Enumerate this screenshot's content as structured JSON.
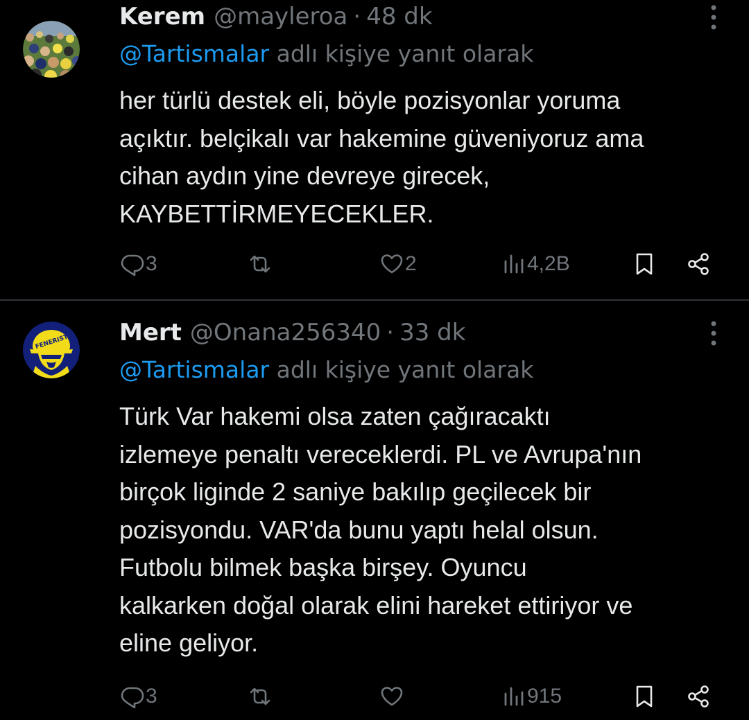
{
  "tweets": [
    {
      "name": "Kerem",
      "handle": "@mayleroa",
      "separator": "·",
      "time": "48 dk",
      "reply_mention": "@Tartismalar",
      "reply_suffix": "adlı kişiye yanıt olarak",
      "text_lines": [
        "her türlü destek eli, böyle pozisyonlar yoruma",
        "açıktır. belçikalı var hakemine güveniyoruz ama",
        "cihan aydın yine devreye girecek,",
        "KAYBETTİRMEYECEKLER."
      ],
      "replies": "3",
      "retweets": "",
      "likes": "2",
      "views": "4,2B",
      "avatar_icon": "crowd-photo-avatar"
    },
    {
      "name": "Mert",
      "handle": "@Onana256340",
      "separator": "·",
      "time": "33 dk",
      "reply_mention": "@Tartismalar",
      "reply_suffix": "adlı kişiye yanıt olarak",
      "text_lines": [
        "Türk Var hakemi olsa zaten çağıracaktı",
        "izlemeye penaltı vereceklerdi. PL ve Avrupa'nın",
        "birçok liginde 2 saniye bakılıp geçilecek bir",
        "pozisyondu. VAR'da bunu yaptı helal olsun.",
        "Futbolu bilmek başka birşey. Oyuncu",
        "kalkarken doğal olarak elini hareket ettiriyor ve",
        "eline geliyor."
      ],
      "replies": "3",
      "retweets": "",
      "likes": "",
      "views": "915",
      "avatar_icon": "feneristi-logo-avatar",
      "avatar_text": "FENERIST"
    }
  ],
  "colors": {
    "background": "#000000",
    "text": "#e7e9ea",
    "muted": "#71767b",
    "link": "#1d9bf0",
    "divider": "#2f3336",
    "avatar_yellow": "#f2dc1a",
    "avatar_navy": "#13207a"
  },
  "icons": {
    "reply": "reply-icon",
    "retweet": "retweet-icon",
    "like": "heart-icon",
    "views": "views-icon",
    "bookmark": "bookmark-icon",
    "share": "share-icon",
    "more": "more-vertical-icon"
  }
}
